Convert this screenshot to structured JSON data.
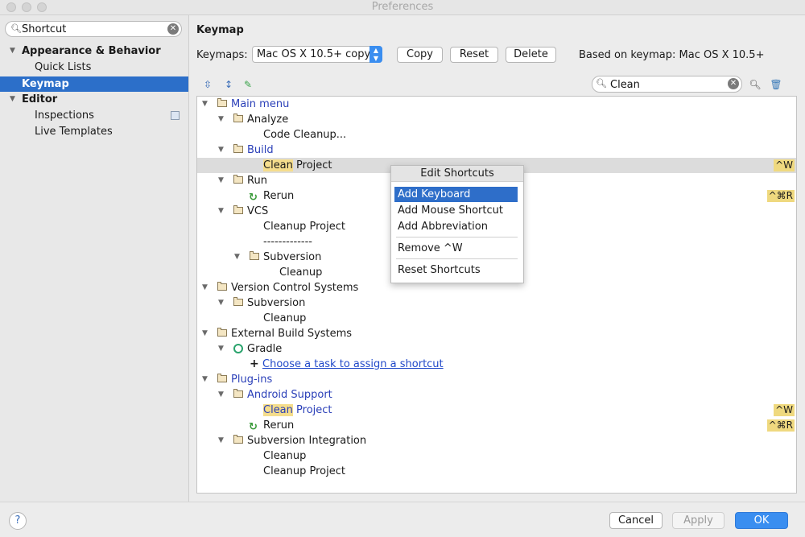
{
  "window": {
    "title": "Preferences"
  },
  "sidebar": {
    "search_value": "Shortcut",
    "items": [
      {
        "label": "Appearance & Behavior"
      },
      {
        "label": "Quick Lists"
      },
      {
        "label": "Keymap"
      },
      {
        "label": "Editor"
      },
      {
        "label": "Inspections"
      },
      {
        "label": "Live Templates"
      }
    ]
  },
  "keymap": {
    "title": "Keymap",
    "keymaps_label": "Keymaps:",
    "selected_keymap": "Mac OS X 10.5+ copy",
    "copy": "Copy",
    "reset": "Reset",
    "delete": "Delete",
    "based_on": "Based on keymap: Mac OS X 10.5+",
    "filter_value": "Clean"
  },
  "tree": {
    "rows": [
      {
        "label": "Main menu"
      },
      {
        "label": "Analyze"
      },
      {
        "label": "Code Cleanup..."
      },
      {
        "label": "Build"
      },
      {
        "hl": "Clean",
        "rest": " Project",
        "shortcut": "^W"
      },
      {
        "label": "Run"
      },
      {
        "label": "Rerun",
        "shortcut": "^⌘R"
      },
      {
        "label": "VCS"
      },
      {
        "label": "Cleanup Project"
      },
      {
        "label": "-------------"
      },
      {
        "label": "Subversion"
      },
      {
        "label": "Cleanup"
      },
      {
        "label": "Version Control Systems"
      },
      {
        "label": "Subversion"
      },
      {
        "label": "Cleanup"
      },
      {
        "label": "External Build Systems"
      },
      {
        "label": "Gradle"
      },
      {
        "label": "Choose a task to assign a shortcut"
      },
      {
        "label": "Plug-ins"
      },
      {
        "label": "Android Support"
      },
      {
        "hl": "Clean",
        "rest": " Project",
        "shortcut": "^W"
      },
      {
        "label": "Rerun",
        "shortcut": "^⌘R"
      },
      {
        "label": "Subversion Integration"
      },
      {
        "label": "Cleanup"
      },
      {
        "label": "Cleanup Project"
      }
    ]
  },
  "popup": {
    "title": "Edit Shortcuts",
    "items": [
      "Add Keyboard Shortcut",
      "Add Mouse Shortcut",
      "Add Abbreviation",
      "Remove ^W",
      "Reset Shortcuts"
    ]
  },
  "footer": {
    "help": "?",
    "cancel": "Cancel",
    "apply": "Apply",
    "ok": "OK"
  },
  "colors": {
    "accent": "#2c6fc9",
    "highlight": "#f5dd8c",
    "ok_button": "#3a8ef0"
  }
}
